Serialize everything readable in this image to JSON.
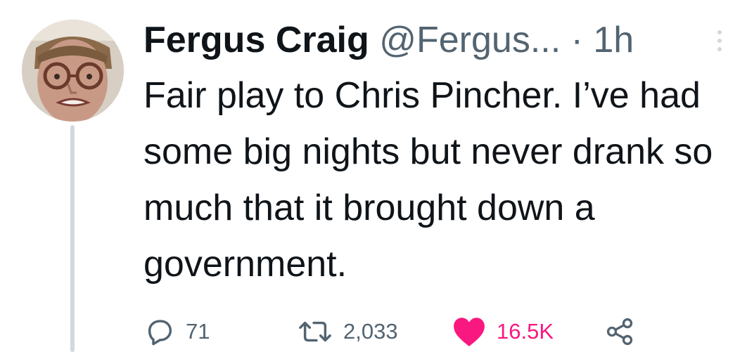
{
  "tweet": {
    "author": {
      "display_name": "Fergus Craig",
      "handle": "@Fergus...",
      "avatar_icon": "avatar-photo-icon"
    },
    "separator": "·",
    "time": "1h",
    "text": "Fair play to Chris Pincher. I’ve had some big nights but never drank so much that it brought down a government.",
    "stats": {
      "replies": "71",
      "retweets": "2,033",
      "likes": "16.5K"
    },
    "icons": {
      "reply": "reply-icon",
      "retweet": "retweet-icon",
      "like": "heart-icon",
      "share": "share-icon",
      "more": "more-icon"
    },
    "colors": {
      "text": "#0f1419",
      "secondary": "#536471",
      "like": "#f91880",
      "thread_line": "#cfd9de"
    }
  }
}
